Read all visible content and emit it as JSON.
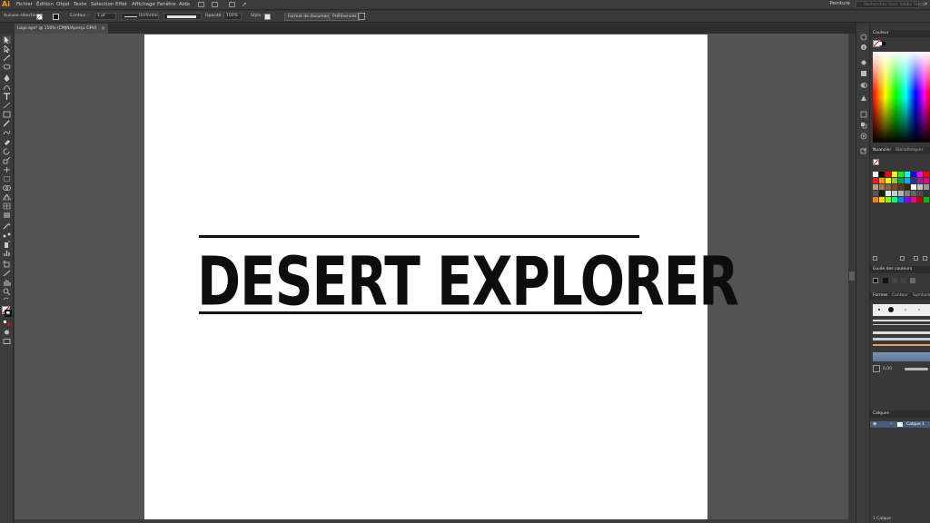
{
  "app": {
    "logo": "Ai"
  },
  "menubar": {
    "items": [
      "Fichier",
      "Édition",
      "Objet",
      "Texte",
      "Sélection",
      "Effet",
      "Affichage",
      "Fenêtre",
      "Aide"
    ],
    "workspace": "Peinture",
    "search_placeholder": "Rechercher dans Adobe Stock"
  },
  "controlbar": {
    "selection_label": "Aucune sélection",
    "contour_label": "Contour :",
    "contour_value": "1 pt",
    "stroke_profile": "Uniforme",
    "opacity_label": "Opacité :",
    "opacity_value": "100%",
    "style_label": "Style :",
    "doc_format_button": "Format de document",
    "preferences_button": "Préférences"
  },
  "document": {
    "tab_title": "Logo.eps* @ 150% (CMJN/Aperçu GPU)",
    "close_glyph": "×"
  },
  "artwork": {
    "logo_text": "DESERT EXPLORER"
  },
  "panels": {
    "color": {
      "title": "Couleur"
    },
    "swatches": {
      "tabs": [
        "Nuancier",
        "Bibliothèques"
      ]
    },
    "color_guide": {
      "title": "Guide des couleurs"
    },
    "brushes": {
      "tabs": [
        "Formes",
        "Contour",
        "Symboles"
      ],
      "size_value": "6,00"
    },
    "layers": {
      "title": "Calques",
      "layer_name": "Calque 1",
      "footer": "1 Calque"
    }
  },
  "colors": {
    "app_bg": "#323232",
    "pasteboard": "#535353",
    "artboard": "#ffffff",
    "accent": "#ff9a00",
    "layer_highlight": "#4a5d78"
  },
  "swatch_rows": [
    [
      "#ffffff",
      "#000000",
      "#ff0000",
      "#ffff00",
      "#00ff00",
      "#00ffff",
      "#0000ff",
      "#ff00ff",
      "#ff0000"
    ],
    [
      "#ed1c24",
      "#f7941d",
      "#fff200",
      "#8dc63f",
      "#00a651",
      "#00aeef",
      "#2e3192",
      "#92278f",
      "#ec008c"
    ],
    [
      "#c69c6d",
      "#a67c52",
      "#8c6239",
      "#754c24",
      "#603913",
      "#3c2415",
      "#ffffff",
      "#c2c2c2",
      "#999999"
    ],
    [
      "#555555",
      "#1a1a1a",
      "#e6e6e6",
      "#cccccc",
      "#b3b3b3",
      "#808080",
      "#666666",
      "#4d4d4d",
      "#333333"
    ],
    [
      "#ff7f00",
      "#ffd400",
      "#7fff00",
      "#00ff7f",
      "#007fff",
      "#7f00ff",
      "#ff007f",
      "#bf0000",
      "#00bf00"
    ]
  ]
}
